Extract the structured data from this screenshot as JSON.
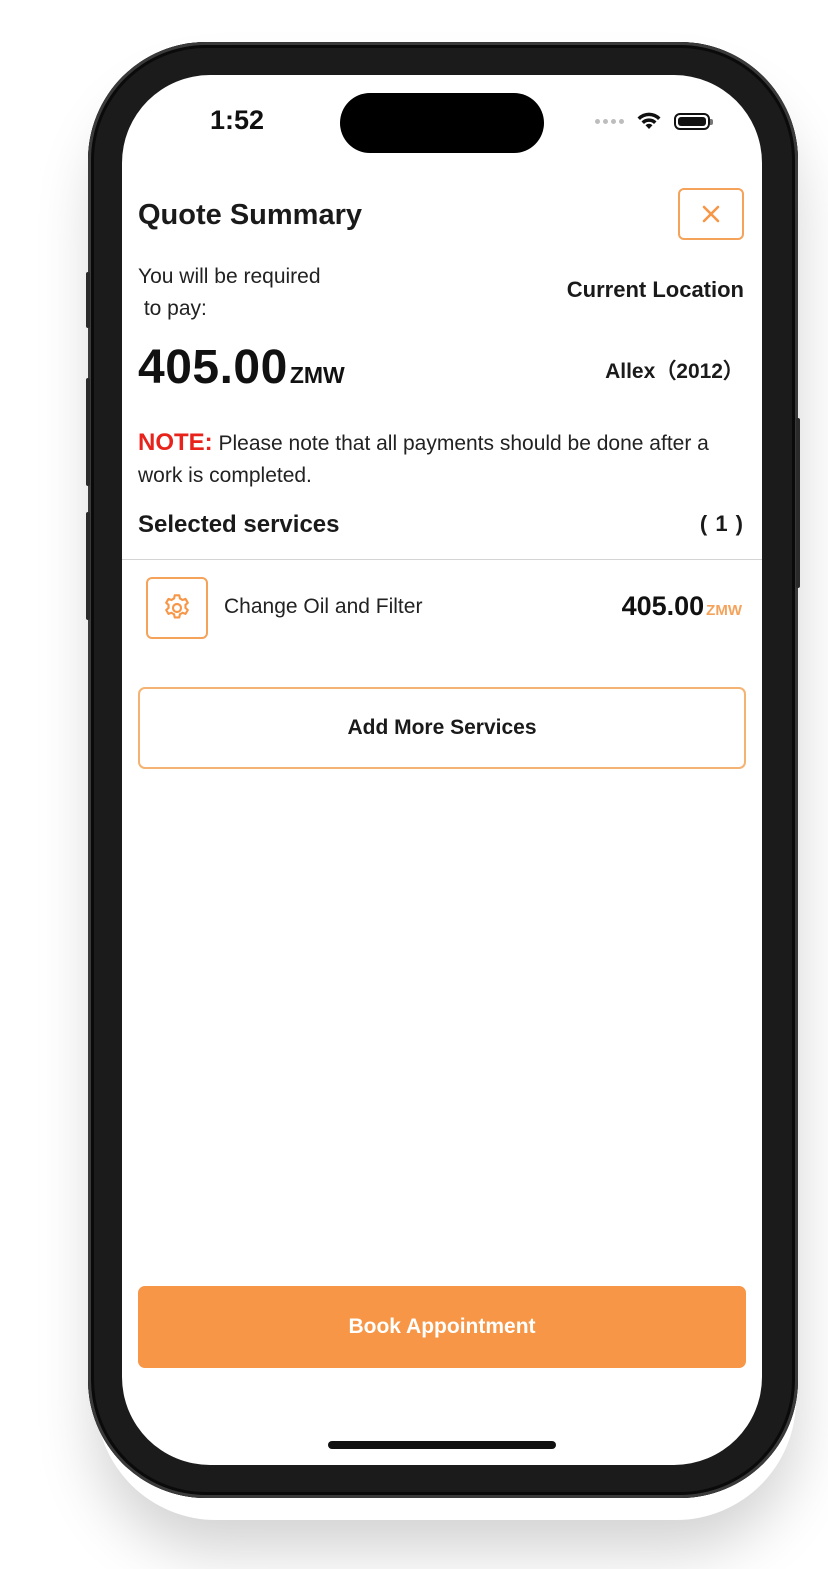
{
  "status_bar": {
    "time": "1:52",
    "wifi_icon": "wifi-icon",
    "battery_icon": "battery-icon"
  },
  "header": {
    "title": "Quote Summary",
    "close_icon": "close-icon"
  },
  "summary": {
    "pay_label": "You will be required\n to pay:",
    "current_location": "Current Location",
    "amount": "405.00",
    "currency": "ZMW",
    "vehicle": "Allex（2012）"
  },
  "note": {
    "label": "NOTE:",
    "text": " Please note that all payments should be done after a work is completed."
  },
  "services": {
    "title": "Selected services",
    "count": "( 1 )",
    "items": [
      {
        "icon": "gear-icon",
        "name": "Change Oil and Filter",
        "price": "405.00",
        "currency": "ZMW"
      }
    ]
  },
  "actions": {
    "add_more_label": "Add More Services",
    "book_label": "Book Appointment"
  },
  "colors": {
    "accent": "#f79646",
    "note_red": "#e8231c",
    "text": "#1a1a1a"
  }
}
